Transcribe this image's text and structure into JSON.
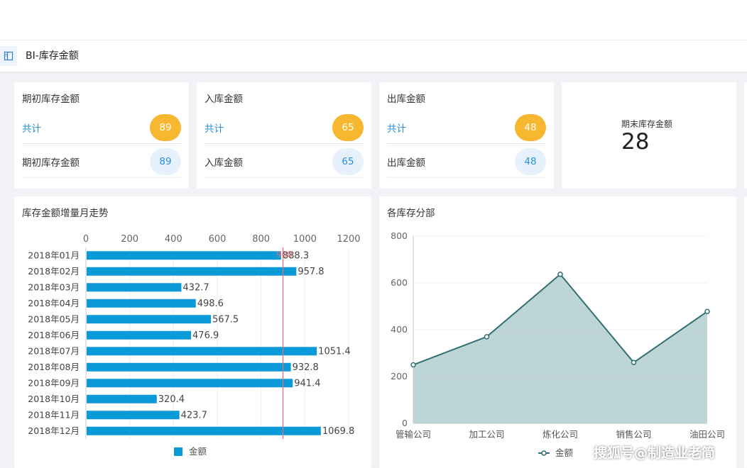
{
  "header": {
    "title": "BI-库存金额"
  },
  "cards": [
    {
      "title": "期初库存金额",
      "total_label": "共计",
      "total_value": "89",
      "item_label": "期初库存金额",
      "item_value": "89"
    },
    {
      "title": "入库金额",
      "total_label": "共计",
      "total_value": "65",
      "item_label": "入库金额",
      "item_value": "65"
    },
    {
      "title": "出库金额",
      "total_label": "共计",
      "total_value": "48",
      "item_label": "出库金额",
      "item_value": "48"
    }
  ],
  "kpi": {
    "label": "期末库存金额",
    "value": "28"
  },
  "chart_data": [
    {
      "type": "bar",
      "orientation": "horizontal",
      "title": "库存金额增量月走势",
      "categories": [
        "2018年01月",
        "2018年02月",
        "2018年03月",
        "2018年04月",
        "2018年05月",
        "2018年06月",
        "2018年07月",
        "2018年08月",
        "2018年09月",
        "2018年10月",
        "2018年11月",
        "2018年12月"
      ],
      "series": [
        {
          "name": "金额",
          "values": [
            888.3,
            957.8,
            432.7,
            498.6,
            567.5,
            476.9,
            1051.4,
            932.8,
            941.4,
            320.4,
            423.7,
            1069.8
          ]
        }
      ],
      "xlim": [
        0,
        1200
      ],
      "xticks": [
        0,
        200,
        400,
        600,
        800,
        1000,
        1200
      ],
      "reference_line": {
        "value": 900,
        "label": "900"
      },
      "legend": "bottom",
      "colors": {
        "bar": "#0b9ad8",
        "reference": "#e46d79"
      }
    },
    {
      "type": "area",
      "title": "各库存分部",
      "categories": [
        "管输公司",
        "加工公司",
        "炼化公司",
        "销售公司",
        "油田公司"
      ],
      "series": [
        {
          "name": "金额",
          "values": [
            250,
            370,
            637,
            260,
            478
          ]
        }
      ],
      "ylim": [
        0,
        800
      ],
      "yticks": [
        0,
        200,
        400,
        600,
        800
      ],
      "legend": "bottom-right",
      "colors": {
        "line": "#2f6f73",
        "fill": "#b7d0d2"
      }
    }
  ],
  "watermark": "搜狐号@制造业老简"
}
